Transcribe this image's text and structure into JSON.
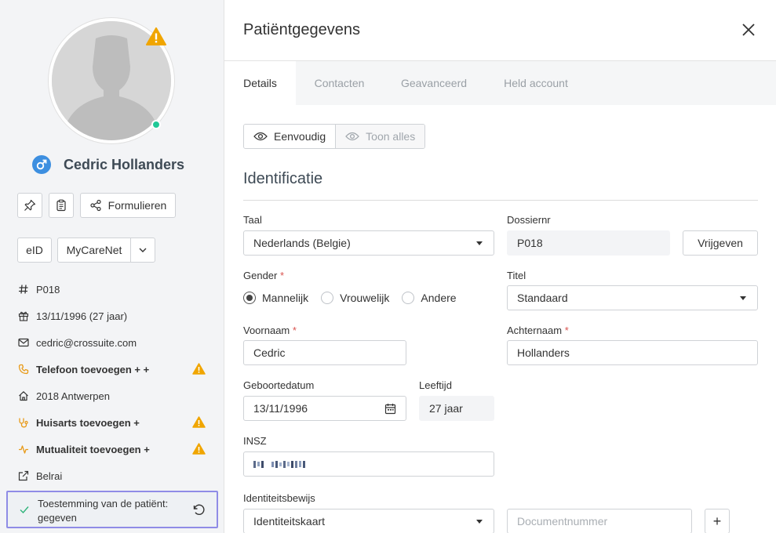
{
  "patient": {
    "name": "Cedric Hollanders",
    "gender_symbol": "♂"
  },
  "sidebar": {
    "buttons": {
      "forms_label": "Formulieren",
      "eid_label": "eID",
      "mycarenet_label": "MyCareNet"
    },
    "info": {
      "dossier": "P018",
      "birth": "13/11/1996 (27 jaar)",
      "email": "cedric@crossuite.com",
      "phone": "Telefoon toevoegen + +",
      "address": "2018 Antwerpen",
      "gp": "Huisarts toevoegen +",
      "mutuality": "Mutualiteit toevoegen +",
      "belrai": "Belrai"
    },
    "consent": "Toestemming van de patiënt: gegeven"
  },
  "header": {
    "title": "Patiëntgegevens"
  },
  "tabs": [
    {
      "label": "Details",
      "active": true
    },
    {
      "label": "Contacten",
      "active": false
    },
    {
      "label": "Geavanceerd",
      "active": false
    },
    {
      "label": "Held account",
      "active": false
    }
  ],
  "view_toggle": {
    "simple": "Eenvoudig",
    "all": "Toon alles"
  },
  "section": {
    "title": "Identificatie"
  },
  "form": {
    "language": {
      "label": "Taal",
      "value": "Nederlands (Belgie)"
    },
    "dossier": {
      "label": "Dossiernr",
      "value": "P018",
      "release_label": "Vrijgeven"
    },
    "gender": {
      "label": "Gender",
      "required": "*",
      "options": [
        "Mannelijk",
        "Vrouwelijk",
        "Andere"
      ],
      "selected": "Mannelijk"
    },
    "title": {
      "label": "Titel",
      "value": "Standaard"
    },
    "firstname": {
      "label": "Voornaam",
      "required": "*",
      "value": "Cedric"
    },
    "lastname": {
      "label": "Achternaam",
      "required": "*",
      "value": "Hollanders"
    },
    "birthdate": {
      "label": "Geboortedatum",
      "value": "13/11/1996"
    },
    "age": {
      "label": "Leeftijd",
      "value": "27 jaar"
    },
    "insz": {
      "label": "INSZ"
    },
    "id_doc": {
      "label": "Identiteitsbewijs",
      "value": "Identiteitskaart",
      "doc_number_placeholder": "Documentnummer",
      "add_label": "+"
    }
  },
  "colors": {
    "warning": "#f0a500",
    "online": "#20c997",
    "gender_badge": "#3d8fe0",
    "consent_border": "#8f8ce6"
  }
}
